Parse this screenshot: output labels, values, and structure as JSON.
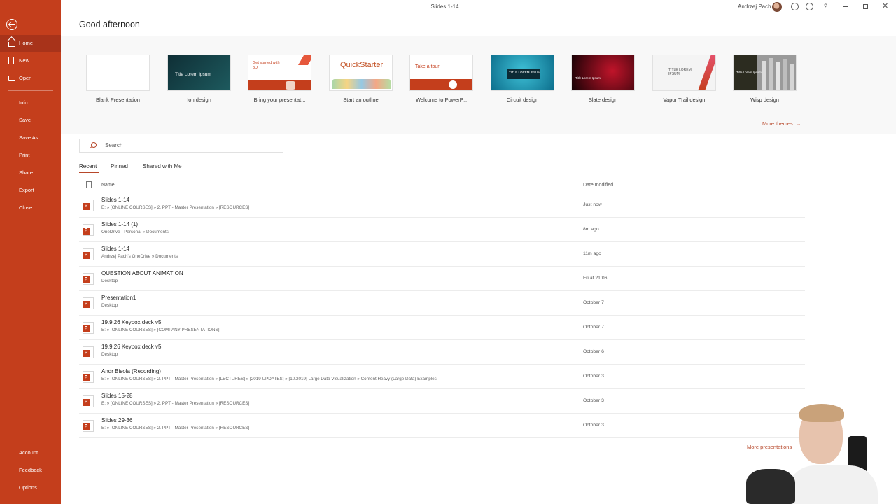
{
  "window": {
    "title": "Slides 1-14",
    "user": "Andrzej Pach"
  },
  "sidebar": {
    "items": [
      {
        "label": "Home",
        "icon": "home-icon"
      },
      {
        "label": "New",
        "icon": "document-icon"
      },
      {
        "label": "Open",
        "icon": "folder-icon"
      },
      {
        "label": "Info"
      },
      {
        "label": "Save"
      },
      {
        "label": "Save As"
      },
      {
        "label": "Print"
      },
      {
        "label": "Share"
      },
      {
        "label": "Export"
      },
      {
        "label": "Close"
      },
      {
        "label": "Account"
      },
      {
        "label": "Feedback"
      },
      {
        "label": "Options"
      }
    ]
  },
  "greeting": "Good afternoon",
  "templates": [
    {
      "label": "Blank Presentation"
    },
    {
      "label": "Ion design",
      "thumb_text": "Title Lorem Ipsum"
    },
    {
      "label": "Bring your presentat...",
      "thumb_text": "Get started with 3D"
    },
    {
      "label": "Start an outline",
      "thumb_text": "QuickStarter"
    },
    {
      "label": "Welcome to PowerP...",
      "thumb_text": "Take a tour"
    },
    {
      "label": "Circuit design",
      "thumb_text": "TITLE LOREM IPSUM"
    },
    {
      "label": "Slate design",
      "thumb_text": "Title Lorem Ipsum"
    },
    {
      "label": "Vapor Trail design",
      "thumb_text": "TITLE LOREM IPSUM"
    },
    {
      "label": "Wisp design",
      "thumb_text": "Title Lorem Ipsum"
    }
  ],
  "more_themes": "More themes",
  "search": {
    "placeholder": "Search"
  },
  "tabs": [
    {
      "label": "Recent",
      "active": true
    },
    {
      "label": "Pinned"
    },
    {
      "label": "Shared with Me"
    }
  ],
  "columns": {
    "name": "Name",
    "date": "Date modified"
  },
  "files": [
    {
      "name": "Slides 1-14",
      "path": "E: » [ONLINE COURSES] » 2. PPT - Master Presentation » [RESOURCES]",
      "date": "Just now"
    },
    {
      "name": "Slides 1-14 (1)",
      "path": "OneDrive - Personal » Documents",
      "date": "8m ago"
    },
    {
      "name": "Slides 1-14",
      "path": "Andrzej Pach's OneDrive » Documents",
      "date": "11m ago"
    },
    {
      "name": "QUESTION ABOUT ANIMATION",
      "path": "Desktop",
      "date": "Fri at 21:06"
    },
    {
      "name": "Presentation1",
      "path": "Desktop",
      "date": "October 7"
    },
    {
      "name": "19.9.26 Keybox deck v5",
      "path": "E: » [ONLINE COURSES] » [COMPANY PRESENTATIONS]",
      "date": "October 7"
    },
    {
      "name": "19.9.26 Keybox deck v5",
      "path": "Desktop",
      "date": "October 6"
    },
    {
      "name": "Andr Bisola (Recording)",
      "path": "E: » [ONLINE COURSES] » 2. PPT - Master Presentation » [LECTURES] » [2019 UPDATES] » [10.2019] Large Data Visualization » Content Heavy (Large Data) Examples",
      "date": "October 3"
    },
    {
      "name": "Slides 15-28",
      "path": "E: » [ONLINE COURSES] » 2. PPT - Master Presentation » [RESOURCES]",
      "date": "October 3"
    },
    {
      "name": "Slides 29-36",
      "path": "E: » [ONLINE COURSES] » 2. PPT - Master Presentation » [RESOURCES]",
      "date": "October 3"
    }
  ],
  "more_presentations": "More presentations",
  "colors": {
    "accent": "#c43e1c",
    "link": "#b7472a"
  }
}
